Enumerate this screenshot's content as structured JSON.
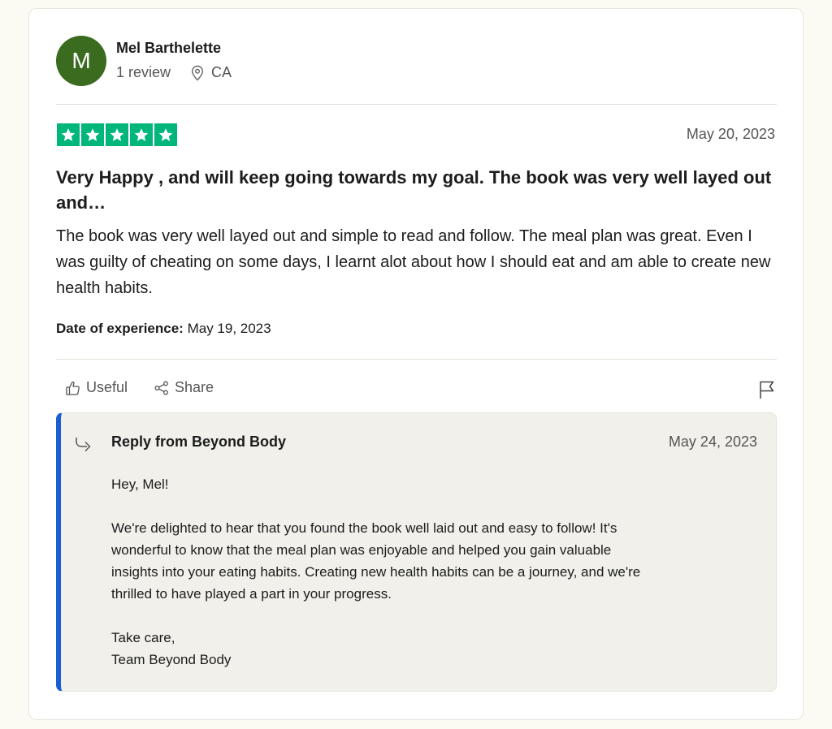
{
  "consumer": {
    "initial": "M",
    "name": "Mel Barthelette",
    "reviews_count": "1 review",
    "location": "CA",
    "avatar_color": "#3a6b1e"
  },
  "review": {
    "rating": 5,
    "rating_color": "#00b67a",
    "date": "May 20, 2023",
    "title": "Very Happy , and will keep going towards my goal. The book was very well layed out and…",
    "body": "The book was very well layed out and simple to read and follow. The meal plan was great. Even I was guilty of cheating on some days, I learnt alot about how I should eat and am able to create new health habits.",
    "experience_label": "Date of experience:",
    "experience_date": "May 19, 2023"
  },
  "actions": {
    "useful_label": "Useful",
    "share_label": "Share"
  },
  "reply": {
    "title": "Reply from Beyond Body",
    "date": "May 24, 2023",
    "greeting": "Hey, Mel!",
    "line1": "We're delighted to hear that you found the book well laid out and easy to follow! It's",
    "line2": "wonderful to know that the meal plan was enjoyable and helped you gain valuable",
    "line3": "insights into your eating habits. Creating new health habits can be a journey, and we're",
    "line4": "thrilled to have played a part in your progress.",
    "signoff": "Take care,",
    "signature": "Team Beyond Body",
    "accent_color": "#1a5fd1"
  }
}
